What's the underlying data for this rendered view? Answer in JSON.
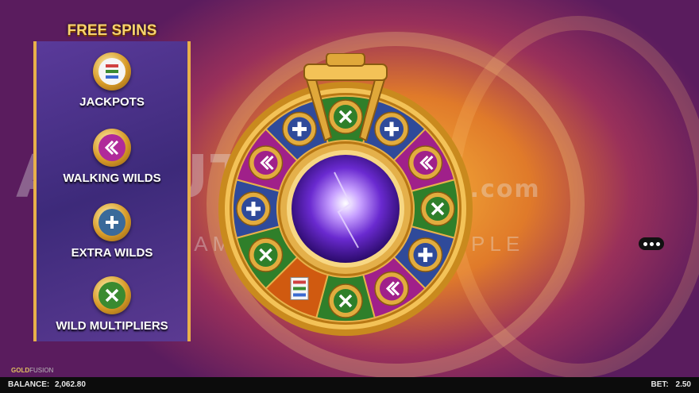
{
  "free_spins_title": "FREE SPINS",
  "features": [
    {
      "label": "JACKPOTS",
      "icon": "jackpot-bars-icon",
      "color": "#e0a020"
    },
    {
      "label": "WALKING WILDS",
      "icon": "walking-wild-chevrons-icon",
      "color": "#b02a9a"
    },
    {
      "label": "EXTRA WILDS",
      "icon": "plus-icon",
      "color": "#3a6a9a"
    },
    {
      "label": "WILD MULTIPLIERS",
      "icon": "x-multiplier-icon",
      "color": "#3a8a30"
    }
  ],
  "wheel": {
    "segments": [
      {
        "color": "#2f7f2a",
        "icon": "x-multiplier-icon"
      },
      {
        "color": "#2f4a9a",
        "icon": "plus-icon"
      },
      {
        "color": "#a0208a",
        "icon": "walking-wild-chevrons-icon"
      },
      {
        "color": "#2f7f2a",
        "icon": "x-multiplier-icon"
      },
      {
        "color": "#2f4a9a",
        "icon": "plus-icon"
      },
      {
        "color": "#a0208a",
        "icon": "walking-wild-chevrons-icon"
      },
      {
        "color": "#2f7f2a",
        "icon": "x-multiplier-icon"
      },
      {
        "color": "#d05a10",
        "icon": "jackpot-bars-icon"
      },
      {
        "color": "#2f7f2a",
        "icon": "x-multiplier-icon"
      },
      {
        "color": "#2f4a9a",
        "icon": "plus-icon"
      },
      {
        "color": "#a0208a",
        "icon": "walking-wild-chevrons-icon"
      },
      {
        "color": "#2f4a9a",
        "icon": "plus-icon"
      }
    ]
  },
  "watermark": {
    "logo": "ABOUTSLOTS",
    "suffix": ".com",
    "tagline": "GAMBLING MADE SIMPLE"
  },
  "game_logo": {
    "part1": "GOLD",
    "part2": "FUSION"
  },
  "balance_label": "BALANCE:",
  "balance_value": "2,062.80",
  "bet_label": "BET:",
  "bet_value": "2.50",
  "colors": {
    "gold": "#e8b04a",
    "panel": "#4a3288"
  }
}
